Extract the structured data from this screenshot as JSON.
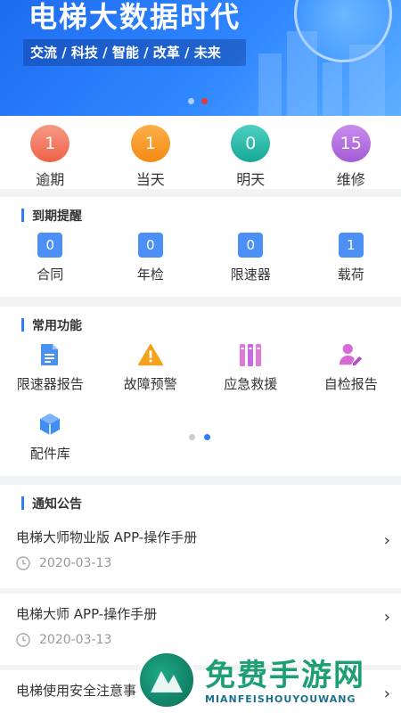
{
  "banner": {
    "title": "电梯大数据时代",
    "subtitle": "交流 / 科技 / 智能 / 改革 / 未来"
  },
  "status": [
    {
      "value": "1",
      "label": "逾期",
      "color": "#f2705a"
    },
    {
      "value": "1",
      "label": "当天",
      "color": "#f7941d"
    },
    {
      "value": "0",
      "label": "明天",
      "color": "#1fb8a8"
    },
    {
      "value": "15",
      "label": "维修",
      "color": "#b36ee0"
    }
  ],
  "expiry": {
    "title": "到期提醒",
    "items": [
      {
        "value": "0",
        "label": "合同"
      },
      {
        "value": "0",
        "label": "年检"
      },
      {
        "value": "0",
        "label": "限速器"
      },
      {
        "value": "1",
        "label": "载荷"
      }
    ]
  },
  "functions": {
    "title": "常用功能",
    "items": [
      {
        "label": "限速器报告",
        "icon": "document-icon"
      },
      {
        "label": "故障预警",
        "icon": "warning-icon"
      },
      {
        "label": "应急救援",
        "icon": "books-icon"
      },
      {
        "label": "自检报告",
        "icon": "user-edit-icon"
      },
      {
        "label": "配件库",
        "icon": "box-icon"
      }
    ]
  },
  "notices": {
    "title": "通知公告",
    "items": [
      {
        "title": "电梯大师物业版 APP-操作手册",
        "date": "2020-03-13"
      },
      {
        "title": "电梯大师 APP-操作手册",
        "date": "2020-03-13"
      },
      {
        "title": "电梯使用安全注意事",
        "date": ""
      }
    ]
  },
  "watermark": {
    "text": "免费手游网",
    "sub": "MIANFEISHOUYOUWANG"
  }
}
